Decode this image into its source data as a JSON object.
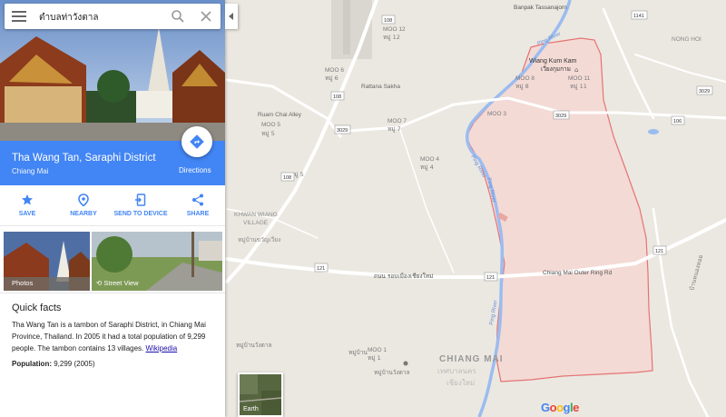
{
  "search": {
    "value": "ตำบลท่าวังตาล",
    "icons": [
      "menu-icon",
      "search-icon",
      "close-icon"
    ]
  },
  "place": {
    "title": "Tha Wang Tan, Saraphi District",
    "subtitle": "Chiang Mai",
    "directions_label": "Directions",
    "accent": "#4285f4"
  },
  "actions": [
    {
      "label": "SAVE",
      "icon": "star-icon"
    },
    {
      "label": "NEARBY",
      "icon": "nearby-icon"
    },
    {
      "label": "SEND TO DEVICE",
      "icon": "send-to-device-icon"
    },
    {
      "label": "SHARE",
      "icon": "share-icon"
    }
  ],
  "photos": {
    "photos_label": "Photos",
    "street_view_label": "Street View"
  },
  "quick_facts": {
    "heading": "Quick facts",
    "text": "Tha Wang Tan is a tambon of Saraphi District, in Chiang Mai Province, Thailand. In 2005 it had a total population of 9,299 people. The tambon contains 13 villages.",
    "link": "Wikipedia",
    "population_label": "Population:",
    "population_value": "9,299 (2005)"
  },
  "map": {
    "colors": {
      "land": "#ebe8e1",
      "boundary": "#e57373",
      "boundary_fill": "#f5d5d0",
      "river": "#9bbcf0",
      "road": "#ffffff"
    },
    "labels": {
      "banpak": "Banpak Tassanajorn",
      "wiang": "Wiang Kum Kam",
      "wiang_th": "เวียงกุมกาม",
      "nong_hoi": "NONG HOI",
      "moo12": "MOO 12",
      "moo12_th": "หมู่ 12",
      "moo6": "MOO 6",
      "moo6_th": "หมู่ 6",
      "moo8": "MOO 8",
      "moo8_th": "หมู่ 8",
      "moo11": "MOO 11",
      "moo11_th": "หมู่ 11",
      "moo3": "MOO 3",
      "moo7": "MOO 7",
      "moo7_th": "หมู่ 7",
      "moo5": "MOO 5",
      "moo5_th": "หมู่ 5",
      "moo5b_th": "หมู่ 5",
      "moo4": "MOO 4",
      "moo4_th": "หมู่ 4",
      "moo1": "MOO 1",
      "moo1_th": "หมู่ 1",
      "rattana": "Rattana Sakha",
      "ruam": "Ruam Chai Alley",
      "khwan": "KHWAN WIANG",
      "village": "VILLAGE",
      "khwan_th": "หมู่บ้านขวัญเวียง",
      "ring_th": "ถนน รอบเมืองเชียงใหม่",
      "ring_en": "Chiang Mai Outer Ring Rd",
      "chiang_mai": "CHIANG MAI",
      "chiang_mai_th": "เทศบาลนคร",
      "chiang_mai_th2": "เชียงใหม่",
      "ping1": "Ping River",
      "ping2": "Ping River",
      "ping3": "Ping River",
      "ping4": "Ping River",
      "village_th1": "หมู่บ้าน",
      "village_th2": "หมู่บ้านวังตาล",
      "village_th3": "หมู่บ้านวังตาล",
      "right_th": "บ้านหนองหอย",
      "r108a": "108",
      "r108b": "108",
      "r108c": "108",
      "r3029a": "3029",
      "r3029b": "3029",
      "r3029c": "3029",
      "r1141": "1141",
      "r106": "106",
      "r121a": "121",
      "r121b": "121",
      "r121c": "121"
    },
    "earth_label": "Earth",
    "google": [
      "G",
      "o",
      "o",
      "g",
      "l",
      "e"
    ]
  }
}
